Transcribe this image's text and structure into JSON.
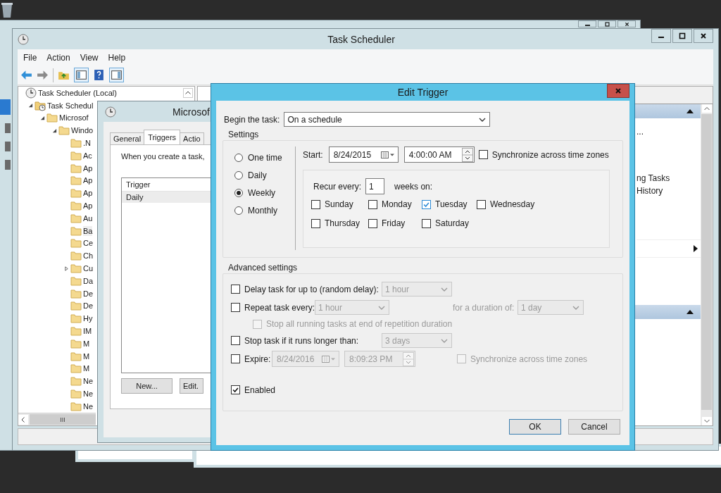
{
  "task_scheduler": {
    "title": "Task Scheduler",
    "menu": [
      "File",
      "Action",
      "View",
      "Help"
    ],
    "tree": [
      {
        "label": "Task Scheduler (Local)",
        "kind": "clock",
        "selected": false,
        "children": [
          {
            "label": "Task Schedul",
            "kind": "clock-folder",
            "expanded": true,
            "selected": false,
            "children": [
              {
                "label": "Microsof",
                "kind": "folder",
                "expanded": true,
                "selected": false,
                "children": [
                  {
                    "label": "Windo",
                    "kind": "folder",
                    "expanded": true,
                    "selected": false,
                    "children": [
                      {
                        "label": ".N",
                        "kind": "folder",
                        "selected": false
                      },
                      {
                        "label": "Ac",
                        "kind": "folder",
                        "selected": false
                      },
                      {
                        "label": "Ap",
                        "kind": "folder",
                        "selected": false
                      },
                      {
                        "label": "Ap",
                        "kind": "folder",
                        "selected": false
                      },
                      {
                        "label": "Ap",
                        "kind": "folder",
                        "selected": false
                      },
                      {
                        "label": "Ap",
                        "kind": "folder",
                        "selected": false
                      },
                      {
                        "label": "Au",
                        "kind": "folder",
                        "selected": false
                      },
                      {
                        "label": "Ba",
                        "kind": "folder",
                        "selected": true
                      },
                      {
                        "label": "Ce",
                        "kind": "folder",
                        "selected": false
                      },
                      {
                        "label": "Ch",
                        "kind": "folder",
                        "selected": false
                      },
                      {
                        "label": "Cu",
                        "kind": "folder",
                        "expanded": false,
                        "selected": false
                      },
                      {
                        "label": "Da",
                        "kind": "folder",
                        "selected": false
                      },
                      {
                        "label": "De",
                        "kind": "folder",
                        "selected": false
                      },
                      {
                        "label": "De",
                        "kind": "folder",
                        "selected": false
                      },
                      {
                        "label": "Hy",
                        "kind": "folder",
                        "selected": false
                      },
                      {
                        "label": "IM",
                        "kind": "folder",
                        "selected": false
                      },
                      {
                        "label": "M",
                        "kind": "folder",
                        "selected": false
                      },
                      {
                        "label": "M",
                        "kind": "folder",
                        "selected": false
                      },
                      {
                        "label": "M",
                        "kind": "folder",
                        "selected": false
                      },
                      {
                        "label": "Ne",
                        "kind": "folder",
                        "selected": false
                      },
                      {
                        "label": "Ne",
                        "kind": "folder",
                        "selected": false
                      },
                      {
                        "label": "Ne",
                        "kind": "folder",
                        "selected": false
                      }
                    ]
                  }
                ]
              }
            ]
          }
        ]
      }
    ],
    "actions": [
      {
        "expanded": true,
        "items": [
          {
            "kind": "text",
            "label": "..."
          },
          {
            "kind": "text",
            "label": "ng Tasks"
          },
          {
            "kind": "text",
            "label": "History"
          },
          {
            "kind": "submenu"
          }
        ]
      },
      {
        "expanded": true
      }
    ]
  },
  "properties_dialog": {
    "title": "Microsof",
    "tabs": [
      {
        "label": "General",
        "selected": false
      },
      {
        "label": "Triggers",
        "selected": true
      },
      {
        "label": "Actio",
        "selected": false
      }
    ],
    "intro": "When you create a task,",
    "list_header": "Trigger",
    "rows": [
      {
        "text": "Daily",
        "selected": true
      }
    ],
    "buttons": [
      "New...",
      "Edit."
    ]
  },
  "edit_trigger": {
    "title": "Edit Trigger",
    "begin_label": "Begin the task:",
    "begin_value": "On a schedule",
    "settings_label": "Settings",
    "schedule": [
      {
        "label": "One time",
        "selected": false
      },
      {
        "label": "Daily",
        "selected": false
      },
      {
        "label": "Weekly",
        "selected": true
      },
      {
        "label": "Monthly",
        "selected": false
      }
    ],
    "start_label": "Start:",
    "start_date": "8/24/2015",
    "start_time": "4:00:00 AM",
    "sync": {
      "label": "Synchronize across time zones",
      "checked": false
    },
    "recur_label": "Recur every:",
    "recur_value": "1",
    "recur_unit": "weeks on:",
    "days": [
      {
        "label": "Sunday",
        "checked": false
      },
      {
        "label": "Monday",
        "checked": false
      },
      {
        "label": "Tuesday",
        "checked": true
      },
      {
        "label": "Wednesday",
        "checked": false
      },
      {
        "label": "Thursday",
        "checked": false
      },
      {
        "label": "Friday",
        "checked": false
      },
      {
        "label": "Saturday",
        "checked": false
      }
    ],
    "advanced_label": "Advanced settings",
    "delay": {
      "label": "Delay task for up to (random delay):",
      "checked": false,
      "value": "1 hour"
    },
    "repeat": {
      "label": "Repeat task every:",
      "checked": false,
      "value": "1 hour",
      "duration_label": "for a duration of:",
      "duration_value": "1 day"
    },
    "stop_all": {
      "label": "Stop all running tasks at end of repetition duration",
      "checked": false
    },
    "stop_long": {
      "label": "Stop task if it runs longer than:",
      "checked": false,
      "value": "3 days"
    },
    "expire": {
      "label": "Expire:",
      "checked": false,
      "date": "8/24/2016",
      "time": "8:09:23 PM",
      "sync_label": "Synchronize across time zones",
      "sync_checked": false
    },
    "enabled": {
      "label": "Enabled",
      "checked": true
    },
    "buttons": [
      "OK",
      "Cancel"
    ]
  }
}
